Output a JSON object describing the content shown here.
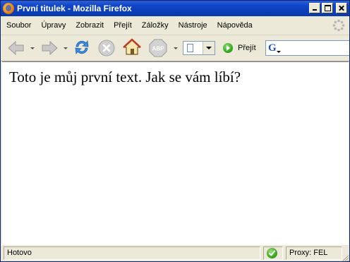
{
  "window": {
    "title": "První titulek - Mozilla Firefox"
  },
  "menu": {
    "items": [
      {
        "label": "Soubor"
      },
      {
        "label": "Úpravy"
      },
      {
        "label": "Zobrazit"
      },
      {
        "label": "Přejít"
      },
      {
        "label": "Záložky"
      },
      {
        "label": "Nástroje"
      },
      {
        "label": "Nápověda"
      }
    ]
  },
  "toolbar": {
    "back_icon": "back-arrow-icon",
    "forward_icon": "forward-arrow-icon",
    "reload_icon": "reload-icon",
    "stop_icon": "stop-icon",
    "home_icon": "home-icon",
    "adblock_label": "ABP",
    "go_label": "Přejít",
    "address_value": "",
    "search_value": "",
    "search_engine_letter": "G"
  },
  "content": {
    "text": "Toto je můj první text. Jak se vám líbí?"
  },
  "status": {
    "text": "Hotovo",
    "proxy": "Proxy: FEL"
  },
  "colors": {
    "titlebar": "#0a3fb8",
    "chrome": "#ece9d8",
    "page": "#ffffff"
  }
}
